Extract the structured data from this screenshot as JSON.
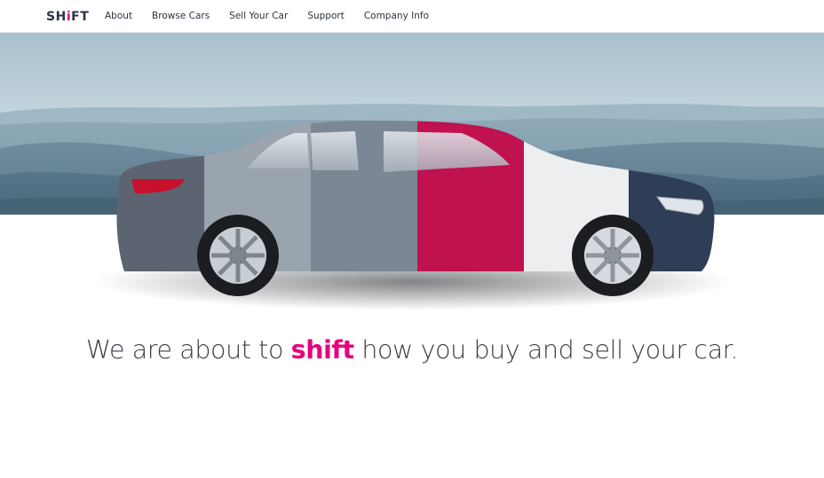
{
  "brand": {
    "logo_prefix": "SH",
    "logo_accent": "i",
    "logo_suffix": "FT",
    "accent_color": "#e6007e",
    "text_color": "#2c3340"
  },
  "nav": {
    "items": [
      "About",
      "Browse Cars",
      "Sell Your Car",
      "Support",
      "Company Info"
    ]
  },
  "hero": {
    "image": "car-color-panels-over-hills",
    "panel_colors": [
      "#5b6470",
      "#9aa4ad",
      "#7c8795",
      "#c0124f",
      "#eceef0",
      "#2f3e57"
    ]
  },
  "tagline": {
    "before": "We are about to ",
    "accent": "shift",
    "after": " how you buy and sell your car."
  }
}
